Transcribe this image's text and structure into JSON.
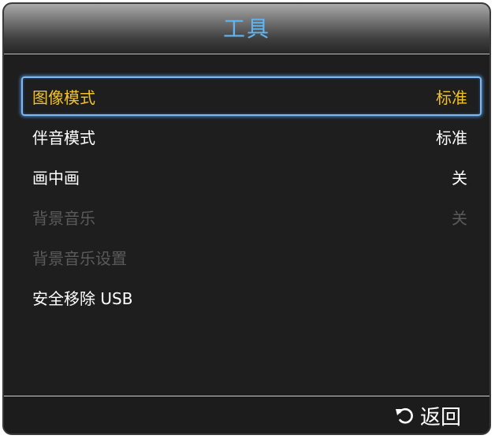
{
  "window": {
    "title": "工具"
  },
  "menu": {
    "items": [
      {
        "label": "图像模式",
        "value": "标准",
        "state": "selected"
      },
      {
        "label": "伴音模式",
        "value": "标准",
        "state": "normal"
      },
      {
        "label": "画中画",
        "value": "关",
        "state": "normal"
      },
      {
        "label": "背景音乐",
        "value": "关",
        "state": "disabled"
      },
      {
        "label": "背景音乐设置",
        "value": "",
        "state": "disabled"
      },
      {
        "label": "安全移除 USB",
        "value": "",
        "state": "normal"
      }
    ]
  },
  "footer": {
    "back_label": "返回",
    "back_icon": "return-arrow-icon"
  },
  "colors": {
    "title": "#5fb6f2",
    "selected_text": "#f2c22a",
    "selection_border": "#7fb7ef",
    "disabled_text": "#5a5a5a",
    "background": "#1e1e1e"
  }
}
